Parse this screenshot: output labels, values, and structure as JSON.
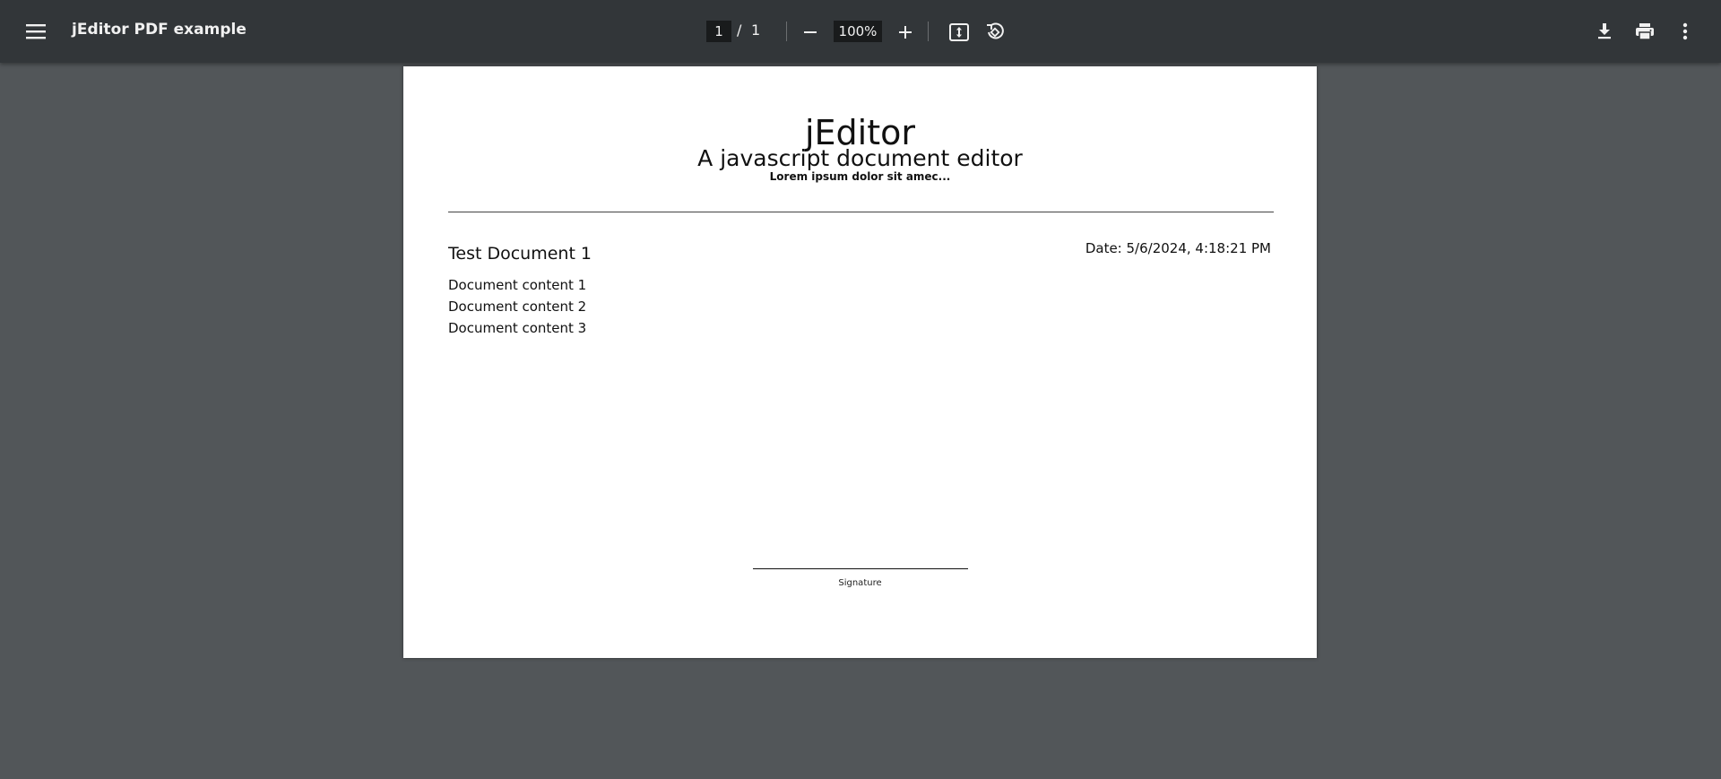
{
  "toolbar": {
    "title": "jEditor PDF example",
    "current_page": "1",
    "page_separator": "/",
    "total_pages": "1",
    "zoom": "100%",
    "icons": {
      "menu": "menu-icon",
      "zoom_out": "minus-icon",
      "zoom_in": "plus-icon",
      "fit": "fit-to-page-icon",
      "rotate": "rotate-icon",
      "download": "download-icon",
      "print": "print-icon",
      "more": "more-vert-icon"
    }
  },
  "document": {
    "heading": "jEditor",
    "subheading": "A javascript document editor",
    "tagline": "Lorem ipsum dolor sit amec...",
    "doc_title": "Test Document 1",
    "date": "Date: 5/6/2024, 4:18:21 PM",
    "content": [
      "Document content 1",
      "Document content 2",
      "Document content 3"
    ],
    "signature_label": "Signature"
  },
  "colors": {
    "toolbar_bg": "#323639",
    "viewer_bg": "#525659",
    "page_bg": "#ffffff",
    "input_bg": "#191b1c"
  }
}
